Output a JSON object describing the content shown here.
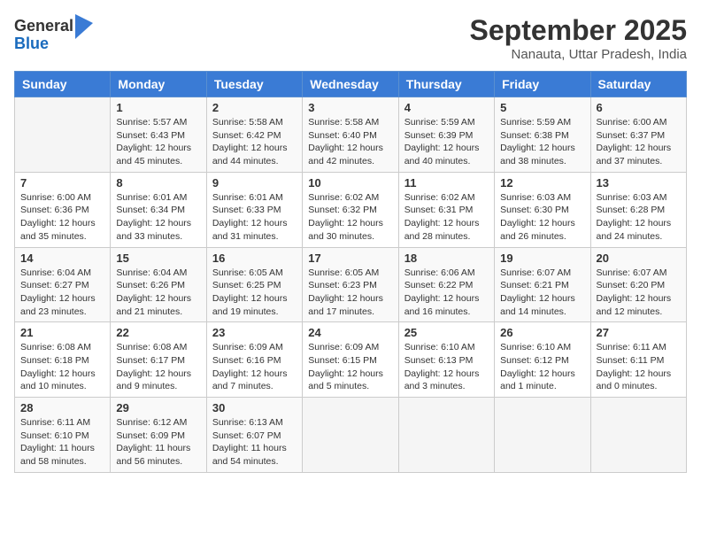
{
  "logo": {
    "line1": "General",
    "line2": "Blue"
  },
  "title": "September 2025",
  "subtitle": "Nanauta, Uttar Pradesh, India",
  "weekdays": [
    "Sunday",
    "Monday",
    "Tuesday",
    "Wednesday",
    "Thursday",
    "Friday",
    "Saturday"
  ],
  "weeks": [
    [
      {
        "day": "",
        "info": ""
      },
      {
        "day": "1",
        "info": "Sunrise: 5:57 AM\nSunset: 6:43 PM\nDaylight: 12 hours\nand 45 minutes."
      },
      {
        "day": "2",
        "info": "Sunrise: 5:58 AM\nSunset: 6:42 PM\nDaylight: 12 hours\nand 44 minutes."
      },
      {
        "day": "3",
        "info": "Sunrise: 5:58 AM\nSunset: 6:40 PM\nDaylight: 12 hours\nand 42 minutes."
      },
      {
        "day": "4",
        "info": "Sunrise: 5:59 AM\nSunset: 6:39 PM\nDaylight: 12 hours\nand 40 minutes."
      },
      {
        "day": "5",
        "info": "Sunrise: 5:59 AM\nSunset: 6:38 PM\nDaylight: 12 hours\nand 38 minutes."
      },
      {
        "day": "6",
        "info": "Sunrise: 6:00 AM\nSunset: 6:37 PM\nDaylight: 12 hours\nand 37 minutes."
      }
    ],
    [
      {
        "day": "7",
        "info": "Sunrise: 6:00 AM\nSunset: 6:36 PM\nDaylight: 12 hours\nand 35 minutes."
      },
      {
        "day": "8",
        "info": "Sunrise: 6:01 AM\nSunset: 6:34 PM\nDaylight: 12 hours\nand 33 minutes."
      },
      {
        "day": "9",
        "info": "Sunrise: 6:01 AM\nSunset: 6:33 PM\nDaylight: 12 hours\nand 31 minutes."
      },
      {
        "day": "10",
        "info": "Sunrise: 6:02 AM\nSunset: 6:32 PM\nDaylight: 12 hours\nand 30 minutes."
      },
      {
        "day": "11",
        "info": "Sunrise: 6:02 AM\nSunset: 6:31 PM\nDaylight: 12 hours\nand 28 minutes."
      },
      {
        "day": "12",
        "info": "Sunrise: 6:03 AM\nSunset: 6:30 PM\nDaylight: 12 hours\nand 26 minutes."
      },
      {
        "day": "13",
        "info": "Sunrise: 6:03 AM\nSunset: 6:28 PM\nDaylight: 12 hours\nand 24 minutes."
      }
    ],
    [
      {
        "day": "14",
        "info": "Sunrise: 6:04 AM\nSunset: 6:27 PM\nDaylight: 12 hours\nand 23 minutes."
      },
      {
        "day": "15",
        "info": "Sunrise: 6:04 AM\nSunset: 6:26 PM\nDaylight: 12 hours\nand 21 minutes."
      },
      {
        "day": "16",
        "info": "Sunrise: 6:05 AM\nSunset: 6:25 PM\nDaylight: 12 hours\nand 19 minutes."
      },
      {
        "day": "17",
        "info": "Sunrise: 6:05 AM\nSunset: 6:23 PM\nDaylight: 12 hours\nand 17 minutes."
      },
      {
        "day": "18",
        "info": "Sunrise: 6:06 AM\nSunset: 6:22 PM\nDaylight: 12 hours\nand 16 minutes."
      },
      {
        "day": "19",
        "info": "Sunrise: 6:07 AM\nSunset: 6:21 PM\nDaylight: 12 hours\nand 14 minutes."
      },
      {
        "day": "20",
        "info": "Sunrise: 6:07 AM\nSunset: 6:20 PM\nDaylight: 12 hours\nand 12 minutes."
      }
    ],
    [
      {
        "day": "21",
        "info": "Sunrise: 6:08 AM\nSunset: 6:18 PM\nDaylight: 12 hours\nand 10 minutes."
      },
      {
        "day": "22",
        "info": "Sunrise: 6:08 AM\nSunset: 6:17 PM\nDaylight: 12 hours\nand 9 minutes."
      },
      {
        "day": "23",
        "info": "Sunrise: 6:09 AM\nSunset: 6:16 PM\nDaylight: 12 hours\nand 7 minutes."
      },
      {
        "day": "24",
        "info": "Sunrise: 6:09 AM\nSunset: 6:15 PM\nDaylight: 12 hours\nand 5 minutes."
      },
      {
        "day": "25",
        "info": "Sunrise: 6:10 AM\nSunset: 6:13 PM\nDaylight: 12 hours\nand 3 minutes."
      },
      {
        "day": "26",
        "info": "Sunrise: 6:10 AM\nSunset: 6:12 PM\nDaylight: 12 hours\nand 1 minute."
      },
      {
        "day": "27",
        "info": "Sunrise: 6:11 AM\nSunset: 6:11 PM\nDaylight: 12 hours\nand 0 minutes."
      }
    ],
    [
      {
        "day": "28",
        "info": "Sunrise: 6:11 AM\nSunset: 6:10 PM\nDaylight: 11 hours\nand 58 minutes."
      },
      {
        "day": "29",
        "info": "Sunrise: 6:12 AM\nSunset: 6:09 PM\nDaylight: 11 hours\nand 56 minutes."
      },
      {
        "day": "30",
        "info": "Sunrise: 6:13 AM\nSunset: 6:07 PM\nDaylight: 11 hours\nand 54 minutes."
      },
      {
        "day": "",
        "info": ""
      },
      {
        "day": "",
        "info": ""
      },
      {
        "day": "",
        "info": ""
      },
      {
        "day": "",
        "info": ""
      }
    ]
  ]
}
